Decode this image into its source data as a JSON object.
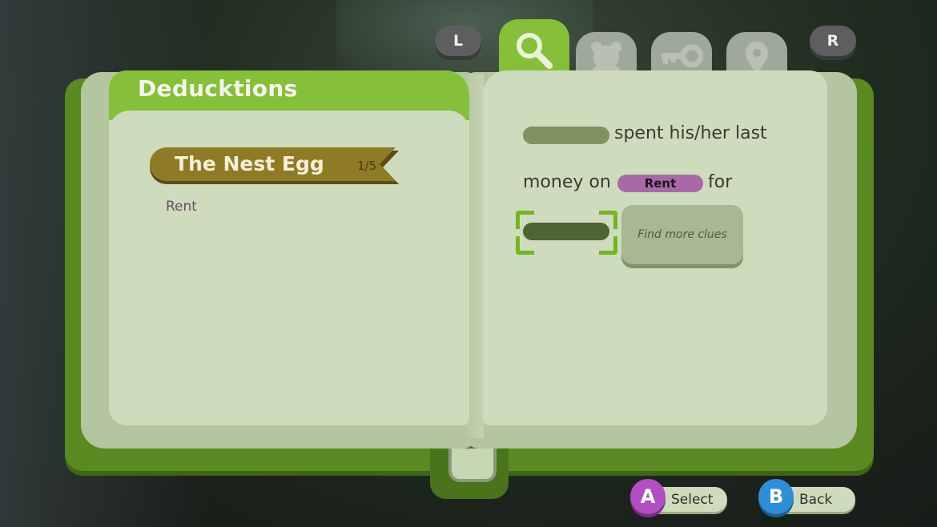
{
  "header": {
    "shoulder_left": "L",
    "shoulder_right": "R",
    "tabs": [
      {
        "icon": "magnifier-icon",
        "active": true
      },
      {
        "icon": "bear-icon",
        "active": false
      },
      {
        "icon": "key-icon",
        "active": false
      },
      {
        "icon": "location-pin-icon",
        "active": false
      }
    ]
  },
  "left_page": {
    "title": "Deducktions",
    "case": {
      "name": "The Nest Egg",
      "progress": "1/5"
    },
    "items": [
      "Rent"
    ]
  },
  "right_page": {
    "line1_text": "spent his/her last",
    "line2_prefix": "money on",
    "line2_tag": "Rent",
    "line2_suffix": "for",
    "hint": "Find more clues"
  },
  "controls": {
    "a_button": "A",
    "a_label": "Select",
    "b_button": "B",
    "b_label": "Back"
  },
  "colors": {
    "accent_green": "#86bf3a",
    "book_green": "#5b8a22",
    "page": "#cfdbbd",
    "ribbon": "#8f7a26",
    "tag_purple": "#a86aa6",
    "a_button": "#b24fc0",
    "b_button": "#2f8fd6"
  }
}
